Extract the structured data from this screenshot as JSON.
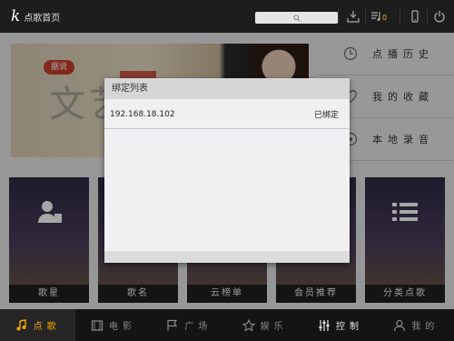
{
  "topbar": {
    "logo_letter": "k",
    "title": "点歌首页",
    "notification_count": "0"
  },
  "main": {
    "banner": {
      "tag": "据说",
      "headline": "文艺"
    },
    "right_menu": [
      {
        "label": "点播历史",
        "icon": "clock-icon"
      },
      {
        "label": "我的收藏",
        "icon": "heart-icon"
      },
      {
        "label": "本地录音",
        "icon": "record-icon"
      }
    ],
    "tiles": [
      {
        "label": "歌星",
        "icon": "singer-icon"
      },
      {
        "label": "歌名",
        "icon": "note-icon"
      },
      {
        "label": "云榜单",
        "icon": "chart-icon"
      },
      {
        "label": "会员推荐",
        "icon": "member-icon"
      },
      {
        "label": "分类点歌",
        "icon": "list-icon"
      }
    ]
  },
  "dialog": {
    "title": "绑定列表",
    "rows": [
      {
        "address": "192.168.18.102",
        "status": "已绑定"
      }
    ]
  },
  "bottom_nav": [
    {
      "label": "点歌",
      "icon": "music-note-icon",
      "active": true
    },
    {
      "label": "电影",
      "icon": "film-icon",
      "active": false
    },
    {
      "label": "广场",
      "icon": "flag-icon",
      "active": false
    },
    {
      "label": "娱乐",
      "icon": "star-icon",
      "active": false
    },
    {
      "label": "控制",
      "icon": "sliders-icon",
      "active": false
    },
    {
      "label": "我的",
      "icon": "user-icon",
      "active": false
    }
  ],
  "colors": {
    "accent": "#f3a600",
    "topbar": "#1d1d1d",
    "dialog_header": "#d6d6d8"
  }
}
